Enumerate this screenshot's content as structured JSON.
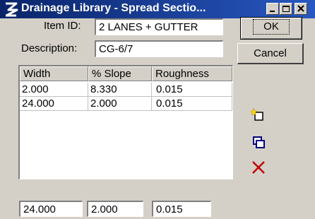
{
  "window": {
    "title": "Drainage Library - Spread Sectio..."
  },
  "form": {
    "item_id_label": "Item ID:",
    "item_id_value": "2 LANES + GUTTER",
    "description_label": "Description:",
    "description_value": "CG-6/7"
  },
  "buttons": {
    "ok_label": "OK",
    "cancel_label": "Cancel"
  },
  "table": {
    "columns": [
      "Width",
      "% Slope",
      "Roughness"
    ],
    "rows": [
      [
        "2.000",
        "8.330",
        "0.015"
      ],
      [
        "24.000",
        "2.000",
        "0.015"
      ]
    ]
  },
  "edit_fields": {
    "width": "24.000",
    "slope": "2.000",
    "roughness": "0.015"
  },
  "tools": {
    "add": "add-row-icon",
    "copy": "copy-row-icon",
    "delete": "delete-row-icon"
  },
  "colors": {
    "title_bar": "#0a246a",
    "delete_icon": "#c00000",
    "face": "#d4d0c8"
  }
}
